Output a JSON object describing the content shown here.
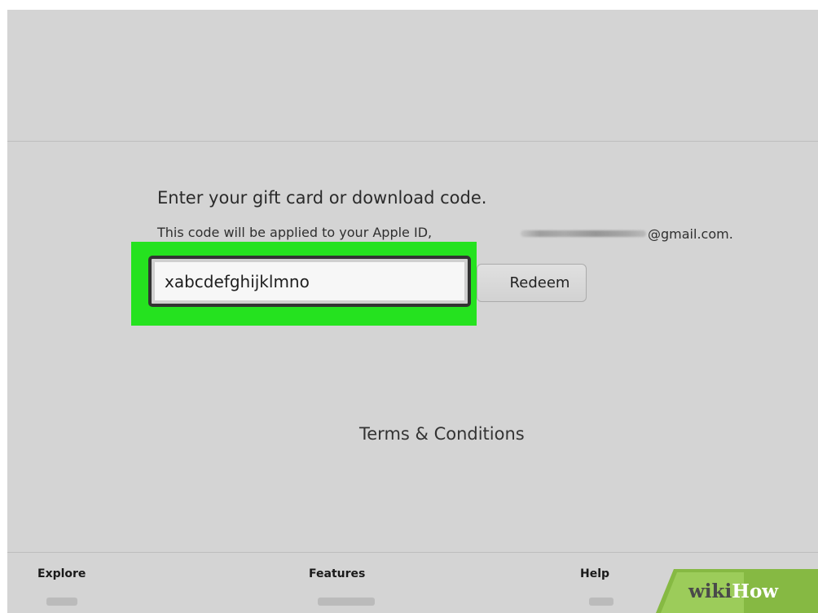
{
  "redeem": {
    "heading": "Enter your gift card or download code.",
    "apple_id_prefix": "This code will be applied to your Apple ID,",
    "apple_id_domain": "@gmail.com.",
    "code_value": "xabcdefghijklmno",
    "redeem_label": "Redeem",
    "highlight_color": "#25e21f"
  },
  "terms": {
    "label": "Terms & Conditions"
  },
  "footer": {
    "columns": [
      {
        "heading": "Explore"
      },
      {
        "heading": "Features"
      },
      {
        "heading": "Help"
      }
    ]
  },
  "watermark": {
    "wiki": "wiki",
    "how": "How",
    "green": "#86b943"
  }
}
